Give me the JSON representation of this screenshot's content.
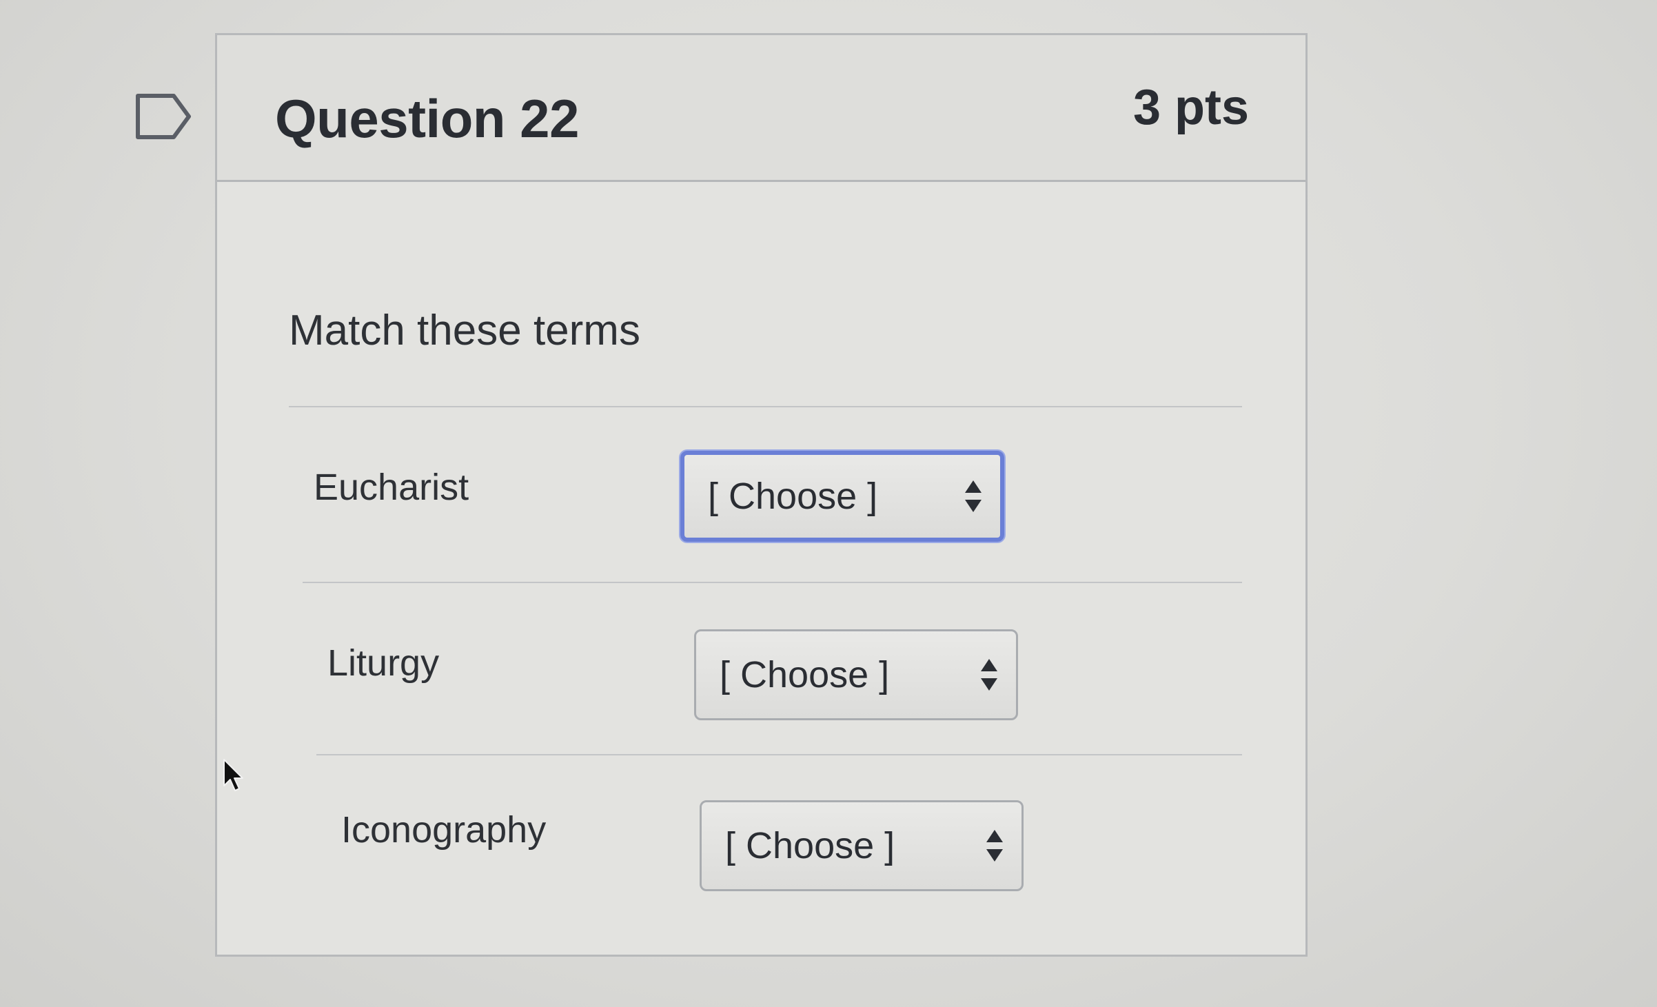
{
  "question": {
    "title": "Question 22",
    "points": "3 pts",
    "prompt": "Match these terms"
  },
  "matches": [
    {
      "term": "Eucharist",
      "selected": "[ Choose ]",
      "focused": true
    },
    {
      "term": "Liturgy",
      "selected": "[ Choose ]",
      "focused": false
    },
    {
      "term": "Iconography",
      "selected": "[ Choose ]",
      "focused": false
    }
  ],
  "colors": {
    "focus_ring": "#6a7fd6",
    "text": "#2a2d33"
  }
}
